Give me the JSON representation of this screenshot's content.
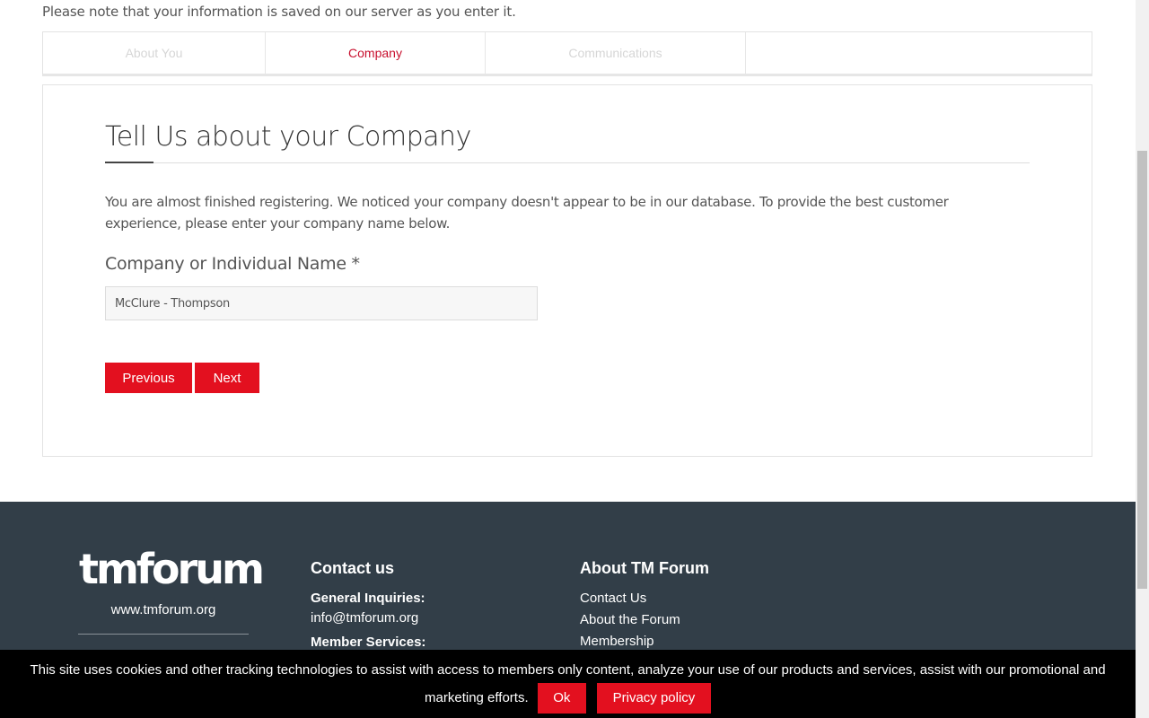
{
  "notice": "Please note that your information is saved on our server as you enter it.",
  "tabs": [
    {
      "label": "About You"
    },
    {
      "label": "Company"
    },
    {
      "label": "Communications"
    },
    {
      "label": ""
    }
  ],
  "form": {
    "title": "Tell Us about your Company",
    "intro": "You are almost finished registering. We noticed your company doesn't appear to be in our database. To provide the best customer experience, please enter your company name below.",
    "field_label": "Company or Individual Name *",
    "field_value": "McClure - Thompson",
    "previous_label": "Previous",
    "next_label": "Next"
  },
  "footer": {
    "logo_text": "tmforum",
    "site_link": "www.tmforum.org",
    "contact": {
      "heading": "Contact us",
      "general_label": "General Inquiries:",
      "general_email": "info@tmforum.org",
      "member_label": "Member Services:"
    },
    "about": {
      "heading": "About TM Forum",
      "links": [
        "Contact Us",
        "About the Forum",
        "Membership"
      ]
    }
  },
  "cookie": {
    "text": "This site uses cookies and other tracking technologies to assist with access to members only content, analyze your use of our products and services, assist with our promotional and marketing efforts.",
    "ok_label": "Ok",
    "privacy_label": "Privacy policy"
  },
  "colors": {
    "accent": "#e3101f",
    "active_tab": "#c8102e",
    "footer_bg": "#323e48",
    "cookie_bg": "#000000"
  }
}
